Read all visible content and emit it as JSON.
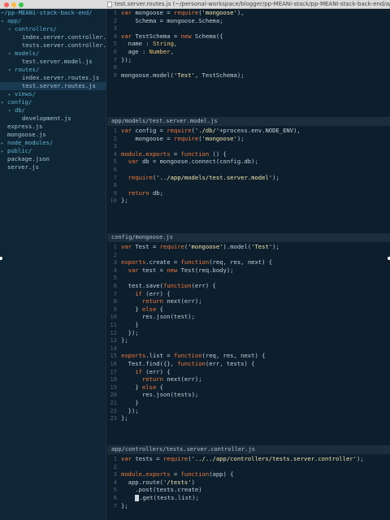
{
  "window": {
    "title": "test.server.routes.js (~/personal-workspace/blogger/pp-MEANi-stack/pp-MEANi-stack-back-end/app"
  },
  "sidebar": {
    "root": "~/pp-MEANi-stack-back-end/",
    "items": [
      {
        "label": "app/",
        "type": "dir",
        "open": true
      },
      {
        "label": "controllers/",
        "type": "dir",
        "open": true
      },
      {
        "label": "index.server.controller.",
        "type": "file"
      },
      {
        "label": "tests.server.controller.",
        "type": "file"
      },
      {
        "label": "models/",
        "type": "dir",
        "open": true
      },
      {
        "label": "test.server.model.js",
        "type": "file"
      },
      {
        "label": "routes/",
        "type": "dir",
        "open": true
      },
      {
        "label": "index.server.routes.js",
        "type": "file"
      },
      {
        "label": "test.server.routes.js",
        "type": "file",
        "selected": true
      },
      {
        "label": "views/",
        "type": "dir",
        "open": false
      },
      {
        "label": "config/",
        "type": "dir",
        "open": true
      },
      {
        "label": "db/",
        "type": "dir",
        "open": true
      },
      {
        "label": "development.js",
        "type": "file"
      },
      {
        "label": "express.js",
        "type": "file"
      },
      {
        "label": "mongoose.js",
        "type": "file"
      },
      {
        "label": "node_modules/",
        "type": "dir",
        "open": false
      },
      {
        "label": "public/",
        "type": "dir",
        "open": false
      },
      {
        "label": "package.json",
        "type": "file"
      },
      {
        "label": "server.js",
        "type": "file"
      }
    ]
  },
  "panes": [
    {
      "header": "",
      "lines": [
        {
          "n": "1",
          "t": "var mongoose = require('mongoose'),"
        },
        {
          "n": "2",
          "t": "    Schema = mongoose.Schema;"
        },
        {
          "n": "3",
          "t": ""
        },
        {
          "n": "4",
          "t": "var TestSchema = new Schema({"
        },
        {
          "n": "5",
          "t": "  name : String,"
        },
        {
          "n": "6",
          "t": "  age : Number,"
        },
        {
          "n": "7",
          "t": "});"
        },
        {
          "n": "8",
          "t": ""
        },
        {
          "n": "9",
          "t": "mongoose.model('Test', TestSchema);"
        }
      ]
    },
    {
      "header": "app/models/test.server.model.js",
      "lines": [
        {
          "n": "1",
          "t": "var config = require('./db/'+process.env.NODE_ENV),"
        },
        {
          "n": "2",
          "t": "    mongoose = require('mongoose');"
        },
        {
          "n": "3",
          "t": ""
        },
        {
          "n": "4",
          "t": "module.exports = function () {"
        },
        {
          "n": "5",
          "t": "  var db = mongoose.connect(config.db);"
        },
        {
          "n": "6",
          "t": ""
        },
        {
          "n": "7",
          "t": "  require('../app/models/test.server.model');"
        },
        {
          "n": "8",
          "t": ""
        },
        {
          "n": "9",
          "t": "  return db;"
        },
        {
          "n": "10",
          "t": "};"
        }
      ]
    },
    {
      "header": "config/mongoose.js",
      "lines": [
        {
          "n": "1",
          "t": "var Test = require('mongoose').model('Test');"
        },
        {
          "n": "2",
          "t": ""
        },
        {
          "n": "3",
          "t": "exports.create = function(req, res, next) {"
        },
        {
          "n": "4",
          "t": "  var test = new Test(req.body);"
        },
        {
          "n": "5",
          "t": ""
        },
        {
          "n": "6",
          "t": "  test.save(function(err) {"
        },
        {
          "n": "7",
          "t": "    if (err) {"
        },
        {
          "n": "8",
          "t": "      return next(err);"
        },
        {
          "n": "9",
          "t": "    } else {"
        },
        {
          "n": "10",
          "t": "      res.json(test);"
        },
        {
          "n": "11",
          "t": "    }"
        },
        {
          "n": "12",
          "t": "  });"
        },
        {
          "n": "13",
          "t": "};"
        },
        {
          "n": "14",
          "t": ""
        },
        {
          "n": "15",
          "t": "exports.list = function(req, res, next) {"
        },
        {
          "n": "16",
          "t": "  Test.find({}, function(err, tests) {"
        },
        {
          "n": "17",
          "t": "    if (err) {"
        },
        {
          "n": "18",
          "t": "      return next(err);"
        },
        {
          "n": "19",
          "t": "    } else {"
        },
        {
          "n": "20",
          "t": "      res.json(tests);"
        },
        {
          "n": "21",
          "t": "    }"
        },
        {
          "n": "22",
          "t": "  });"
        },
        {
          "n": "23",
          "t": "};"
        }
      ]
    },
    {
      "header": "app/controllers/tests.server.controller.js",
      "lines": [
        {
          "n": "1",
          "t": "var tests = require('../../app/controllers/tests.server.controller');"
        },
        {
          "n": "2",
          "t": ""
        },
        {
          "n": "3",
          "t": "module.exports = function(app) {"
        },
        {
          "n": "4",
          "t": "  app.route('/tests')"
        },
        {
          "n": "5",
          "t": "    .post(tests.create)"
        },
        {
          "n": "6",
          "t": "    .get(tests.list);"
        },
        {
          "n": "7",
          "t": "};"
        }
      ]
    }
  ],
  "colors": {
    "background": "#0d1f2d",
    "keyword": "#f3793b",
    "string": "#f3e6ae",
    "function": "#e7c664",
    "folder": "#5fb3d4"
  },
  "icons": {
    "folder_open": "chevron-down-icon",
    "folder_closed": "chevron-right-icon"
  }
}
